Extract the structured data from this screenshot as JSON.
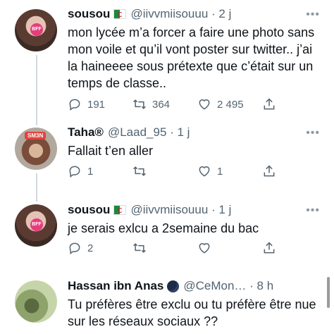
{
  "tweets": [
    {
      "name": "sousou",
      "meta": "@iivvmiisouuu · 2 j",
      "text": "mon lycée m’a forcer a faire une photo sans mon voile et qu’il vont poster sur twitter.. j’ai la haineeee sous prétexte que c’était sur un temps de classe..",
      "replies": "191",
      "retweets": "364",
      "likes": "2 495",
      "avatar_badge": "BFF"
    },
    {
      "name": "Taha®",
      "meta": "@Laad_95 · 1 j",
      "text": "Fallait t’en aller",
      "replies": "1",
      "retweets": "",
      "likes": "1",
      "avatar_badge": "SM3N"
    },
    {
      "name": "sousou",
      "meta": "@iivvmiisouuu · 1 j",
      "text": "je serais exlcu a 2semaine du bac",
      "replies": "2",
      "retweets": "",
      "likes": "",
      "avatar_badge": "BFF"
    },
    {
      "name": "Hassan ibn Anas",
      "meta": "@CeMon… · 8 h",
      "text": "Tu préfères être exclu ou tu préfère être nue sur les réseaux sociaux ??"
    }
  ],
  "more_label": "•••",
  "icons": [
    "reply-icon",
    "retweet-icon",
    "like-icon",
    "share-icon",
    "more-icon",
    "algeria-flag-icon"
  ]
}
